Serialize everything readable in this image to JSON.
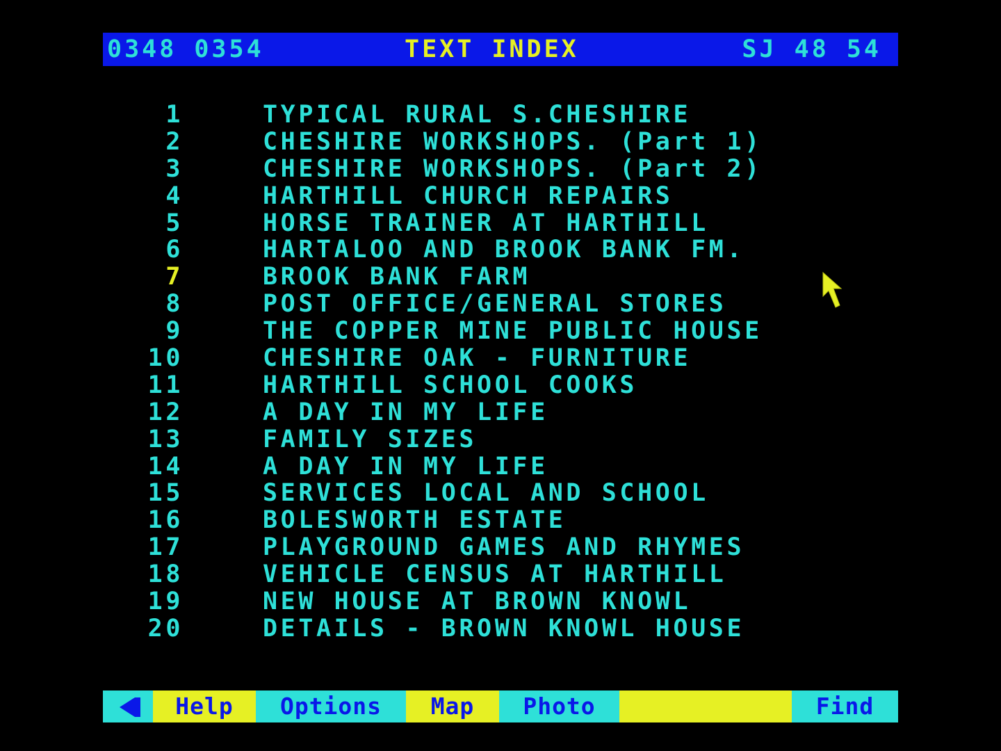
{
  "header": {
    "codes": "0348 0354",
    "title": "TEXT INDEX",
    "grid_ref": "SJ 48 54",
    "background_color": "#0a18e8",
    "title_color": "#e6f024",
    "text_color": "#2ee0d8"
  },
  "index": {
    "selected": "7",
    "items": [
      {
        "num": "1",
        "title": "TYPICAL RURAL S.CHESHIRE"
      },
      {
        "num": "2",
        "title": "CHESHIRE WORKSHOPS. (Part 1)"
      },
      {
        "num": "3",
        "title": "CHESHIRE WORKSHOPS. (Part 2)"
      },
      {
        "num": "4",
        "title": "HARTHILL CHURCH REPAIRS"
      },
      {
        "num": "5",
        "title": "HORSE TRAINER AT HARTHILL"
      },
      {
        "num": "6",
        "title": "HARTALOO AND BROOK BANK FM."
      },
      {
        "num": "7",
        "title": "BROOK BANK FARM"
      },
      {
        "num": "8",
        "title": "POST OFFICE/GENERAL STORES"
      },
      {
        "num": "9",
        "title": "THE COPPER MINE PUBLIC HOUSE"
      },
      {
        "num": "10",
        "title": "CHESHIRE OAK - FURNITURE"
      },
      {
        "num": "11",
        "title": "HARTHILL SCHOOL COOKS"
      },
      {
        "num": "12",
        "title": "A DAY IN MY LIFE"
      },
      {
        "num": "13",
        "title": "FAMILY SIZES"
      },
      {
        "num": "14",
        "title": "A DAY IN MY LIFE"
      },
      {
        "num": "15",
        "title": "SERVICES LOCAL AND SCHOOL"
      },
      {
        "num": "16",
        "title": "BOLESWORTH ESTATE"
      },
      {
        "num": "17",
        "title": "PLAYGROUND GAMES AND RHYMES"
      },
      {
        "num": "18",
        "title": "VEHICLE CENSUS AT HARTHILL"
      },
      {
        "num": "19",
        "title": "NEW HOUSE AT BROWN KNOWL"
      },
      {
        "num": "20",
        "title": "DETAILS - BROWN KNOWL HOUSE"
      }
    ]
  },
  "cursor": {
    "icon": "mouse-pointer-icon",
    "color": "#e6f024"
  },
  "footer": {
    "back_icon": "left-arrow-icon",
    "help": "Help",
    "options": "Options",
    "map": "Map",
    "photo": "Photo",
    "blank": "",
    "find": "Find",
    "cyan_color": "#2ee0d8",
    "yellow_color": "#e6f024",
    "label_color": "#0a18e8"
  }
}
